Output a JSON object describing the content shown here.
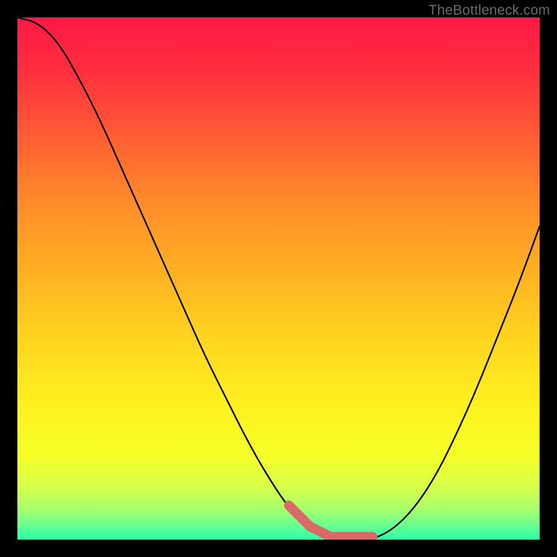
{
  "credit": "TheBottleneck.com",
  "chart_data": {
    "type": "line",
    "title": "",
    "xlabel": "",
    "ylabel": "",
    "xlim": [
      0,
      100
    ],
    "ylim": [
      0,
      100
    ],
    "grid": false,
    "series": [
      {
        "name": "curve",
        "x": [
          0,
          4,
          8,
          12,
          16,
          20,
          24,
          28,
          32,
          36,
          40,
          44,
          48,
          52,
          56,
          60,
          64,
          68,
          72,
          76,
          80,
          84,
          88,
          92,
          96,
          100
        ],
        "y": [
          100,
          99,
          95,
          88,
          80,
          71,
          62,
          53,
          44,
          35,
          27,
          19,
          12,
          6,
          2,
          0,
          0,
          0,
          2,
          6,
          12,
          20,
          29,
          39,
          49,
          60
        ]
      }
    ],
    "plateau_range": [
      54,
      68
    ],
    "background_gradient": {
      "stops": [
        {
          "offset": 0.0,
          "color": "#ff1846"
        },
        {
          "offset": 0.1,
          "color": "#ff2e3f"
        },
        {
          "offset": 0.22,
          "color": "#ff5a34"
        },
        {
          "offset": 0.35,
          "color": "#ff8a2a"
        },
        {
          "offset": 0.5,
          "color": "#ffb422"
        },
        {
          "offset": 0.62,
          "color": "#ffd61f"
        },
        {
          "offset": 0.74,
          "color": "#fff01f"
        },
        {
          "offset": 0.84,
          "color": "#f5ff28"
        },
        {
          "offset": 0.9,
          "color": "#d6ff4a"
        },
        {
          "offset": 0.94,
          "color": "#aaff6a"
        },
        {
          "offset": 0.97,
          "color": "#6fff8e"
        },
        {
          "offset": 1.0,
          "color": "#2bffa8"
        }
      ]
    }
  }
}
